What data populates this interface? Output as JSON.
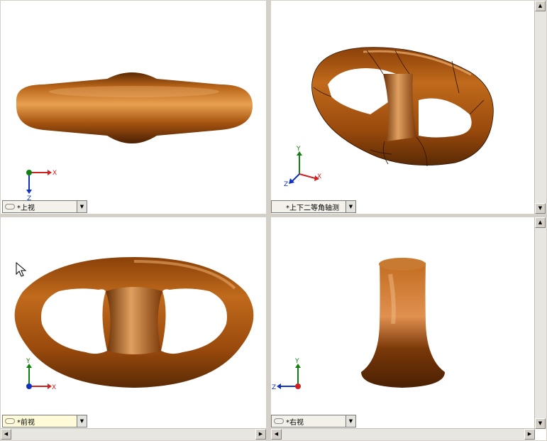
{
  "views": {
    "top_left": {
      "label": "*上视"
    },
    "top_right": {
      "label": "*上下二等角轴测"
    },
    "bottom_left": {
      "label": "*前视"
    },
    "bottom_right": {
      "label": "*右视"
    }
  },
  "axes": {
    "x": "X",
    "y": "Y",
    "z": "Z"
  },
  "colors": {
    "model": "#b05a10",
    "model_highlight": "#e8a050",
    "model_shadow": "#5a2a05",
    "axis_x": "#d02020",
    "axis_y": "#108010",
    "axis_z": "#1030c0",
    "active_selector": "#fffbd8"
  },
  "icons": [
    "view-link-icon",
    "dropdown-arrow-icon",
    "mouse-cursor-icon",
    "scroll-arrow-icon"
  ]
}
